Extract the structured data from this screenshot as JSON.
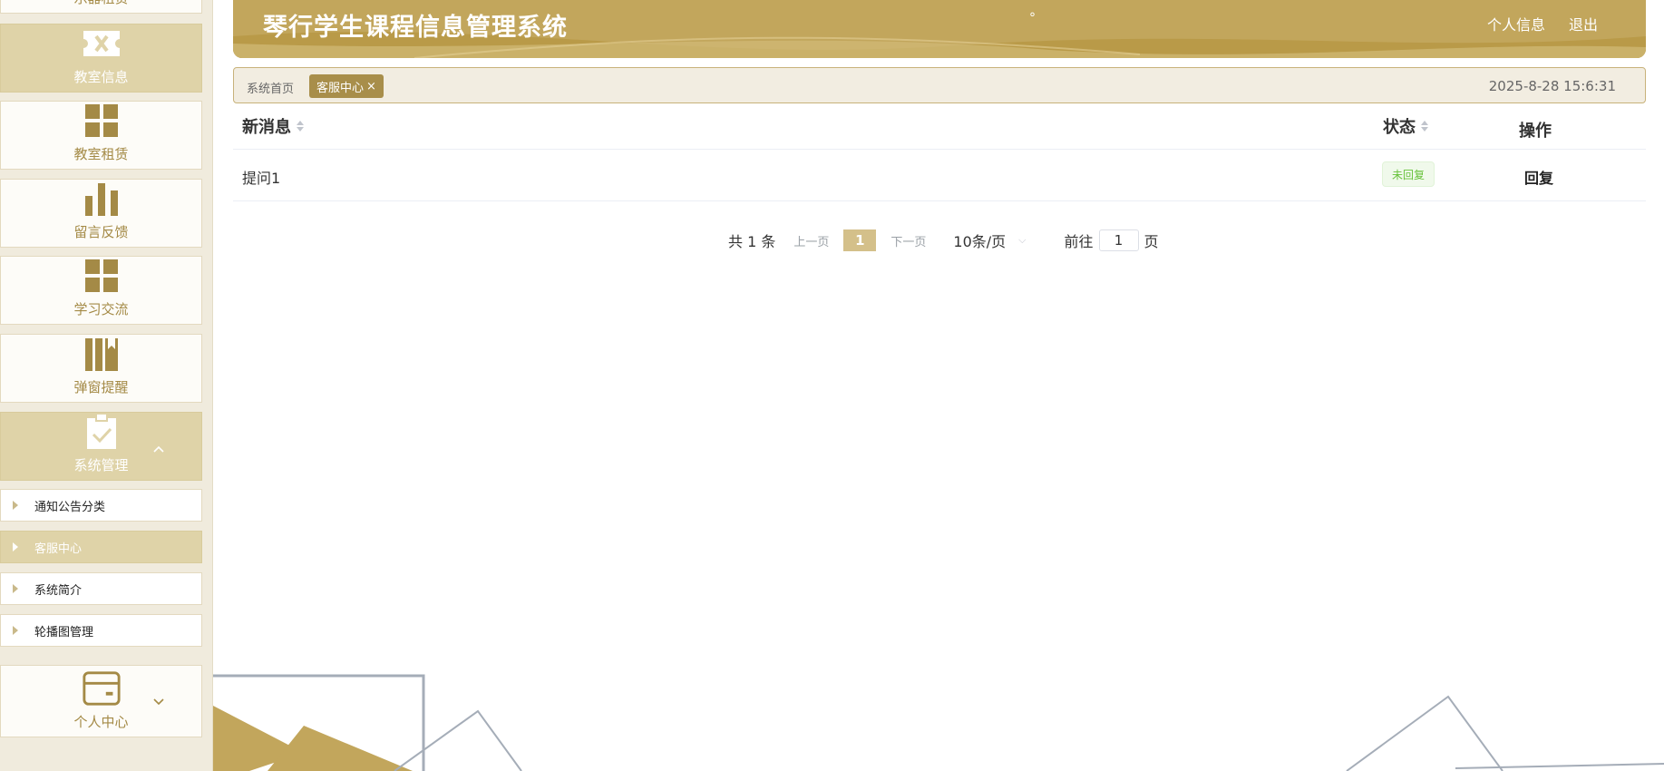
{
  "sidebar": {
    "partial_top_label": "乐器租赁",
    "items": [
      {
        "label": "教室信息",
        "icon": "ticket-icon",
        "active": true
      },
      {
        "label": "教室租赁",
        "icon": "grid-icon",
        "active": false
      },
      {
        "label": "留言反馈",
        "icon": "bar-chart-icon",
        "active": false
      },
      {
        "label": "学习交流",
        "icon": "grid-icon",
        "active": false
      },
      {
        "label": "弹窗提醒",
        "icon": "bookmark-icon",
        "active": false
      },
      {
        "label": "系统管理",
        "icon": "clipboard-check-icon",
        "active": true,
        "expanded": true
      },
      {
        "label": "个人中心",
        "icon": "card-icon",
        "active": false,
        "expanded": false
      }
    ],
    "submenu": [
      {
        "label": "通知公告分类",
        "active": false
      },
      {
        "label": "客服中心",
        "active": true
      },
      {
        "label": "系统简介",
        "active": false
      },
      {
        "label": "轮播图管理",
        "active": false
      }
    ]
  },
  "header": {
    "title": "琴行学生课程信息管理系统",
    "dot": "°",
    "profile_link": "个人信息",
    "logout_link": "退出"
  },
  "breadcrumb": {
    "home": "系统首页",
    "tab": "客服中心",
    "close": "×",
    "datetime": "2025-8-28 15:6:31"
  },
  "table": {
    "columns": [
      "新消息",
      "状态",
      "操作"
    ],
    "rows": [
      {
        "message": "提问1",
        "status": "未回复",
        "action": "回复"
      }
    ]
  },
  "pagination": {
    "total": "共 1 条",
    "prev": "上一页",
    "current": "1",
    "next": "下一页",
    "page_size": "10条/页",
    "goto_label": "前往",
    "goto_value": "1",
    "goto_suffix": "页"
  },
  "colors": {
    "brand": "#c2a65c",
    "brand_dark": "#a88e4a",
    "sidebar_active": "#dfd3a8",
    "status_green": "#67c23a"
  }
}
